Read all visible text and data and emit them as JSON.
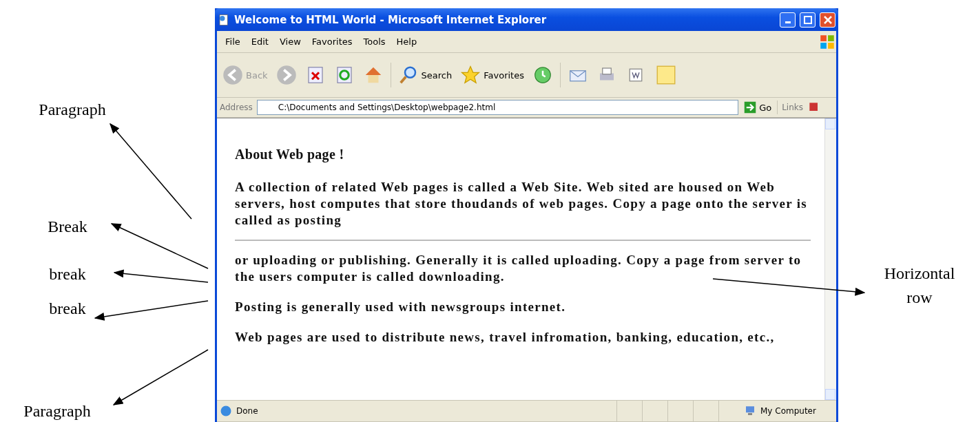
{
  "window": {
    "title": "Welcome to HTML World - Microsoft Internet Explorer"
  },
  "menu": [
    "File",
    "Edit",
    "View",
    "Favorites",
    "Tools",
    "Help"
  ],
  "toolbar": {
    "back": "Back",
    "search": "Search",
    "favorites": "Favorites"
  },
  "address": {
    "label": "Address",
    "value": "C:\\Documents and Settings\\Desktop\\webpage2.html",
    "go": "Go",
    "links": "Links"
  },
  "page": {
    "heading": "About Web page !",
    "blocks": [
      {
        "kind": "text",
        "text": "A collection of related Web pages is called a Web Site. Web sited are housed on Web servers, host computes that store thoudands of web pages. Copy a page onto the server is called as posting"
      },
      {
        "kind": "rule"
      },
      {
        "kind": "text",
        "text": "or uploading or publishing. Generally it is called uploading. Copy a page from server to the users computer is called downloading."
      },
      {
        "kind": "text",
        "text": "Posting is generally used with newsgroups internet."
      },
      {
        "kind": "text",
        "text": "Web pages are used to distribute news, travel infromation, banking, education, etc.,"
      }
    ]
  },
  "status_bar": {
    "status": "Done",
    "zone": "My Computer"
  },
  "left_annotations": [
    {
      "label": "Paragraph"
    },
    {
      "label": "Break"
    },
    {
      "label": "break"
    },
    {
      "label": "break"
    },
    {
      "label": "Paragraph"
    }
  ],
  "right_annotations": [
    {
      "label": "Horizontal row"
    }
  ]
}
